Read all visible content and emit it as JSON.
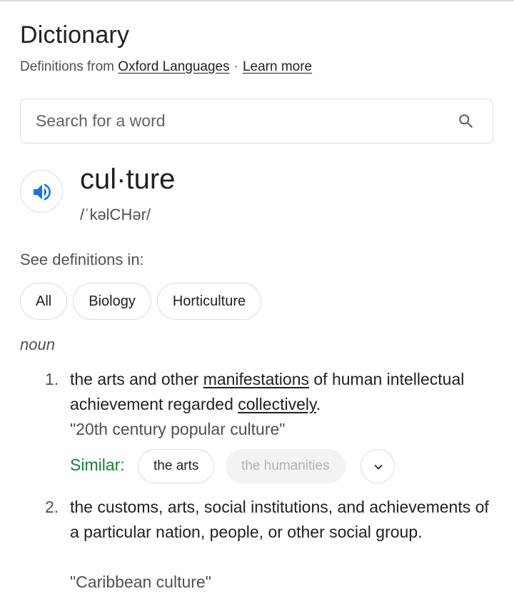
{
  "header": {
    "title": "Dictionary",
    "source_prefix": "Definitions from",
    "source_link": "Oxford Languages",
    "separator": "·",
    "learn_more": "Learn more"
  },
  "search": {
    "placeholder": "Search for a word",
    "value": ""
  },
  "entry": {
    "word": "cul·ture",
    "phonetic": "/ˈkəlCHər/",
    "audio_icon": "speaker-icon"
  },
  "see_definitions": {
    "label": "See definitions in:",
    "chips": [
      "All",
      "Biology",
      "Horticulture"
    ]
  },
  "part_of_speech": "noun",
  "definitions": [
    {
      "number": "1.",
      "text_parts": {
        "a": "the arts and other ",
        "link1": "manifestations",
        "b": " of human intellectual achievement regarded ",
        "link2": "collectively",
        "c": "."
      },
      "example": "\"20th century popular culture\"",
      "similar_label": "Similar:",
      "similar": [
        "the arts",
        "the humanities"
      ]
    },
    {
      "number": "2.",
      "text": "the customs, arts, social institutions, and achievements of a particular nation, people, or other social group.",
      "example": "\"Caribbean culture\""
    }
  ],
  "colors": {
    "accent_blue": "#1a73e8",
    "similar_green": "#188038",
    "border": "#dadce0"
  }
}
